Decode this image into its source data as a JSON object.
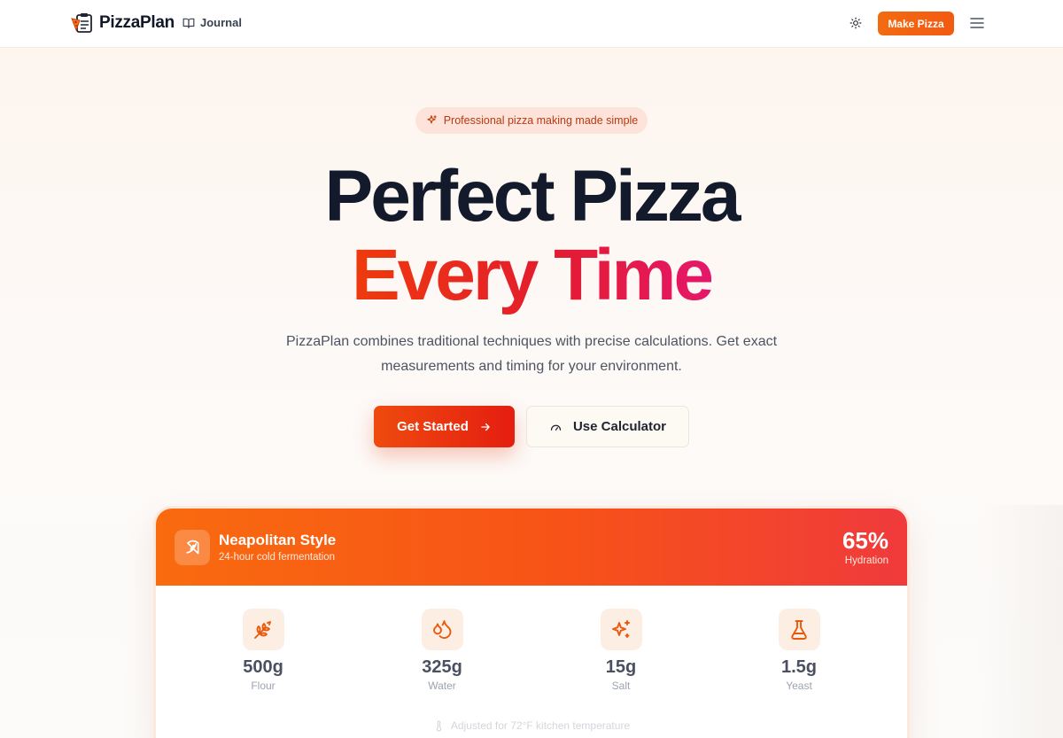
{
  "header": {
    "brand": "PizzaPlan",
    "nav_journal": "Journal",
    "make_button": "Make Pizza"
  },
  "hero": {
    "pill": "Professional pizza making made simple",
    "title_line1": "Perfect Pizza",
    "title_line2": "Every Time",
    "subtitle": "PizzaPlan combines traditional techniques with precise calculations. Get exact measurements and timing for your environment.",
    "primary_button": "Get Started",
    "secondary_button": "Use Calculator"
  },
  "recipe": {
    "title": "Neapolitan Style",
    "subtitle": "24-hour cold fermentation",
    "hydration_value": "65%",
    "hydration_label": "Hydration",
    "ingredients": [
      {
        "value": "500g",
        "label": "Flour",
        "icon": "wheat-icon"
      },
      {
        "value": "325g",
        "label": "Water",
        "icon": "droplets-icon"
      },
      {
        "value": "15g",
        "label": "Salt",
        "icon": "sparkles-icon"
      },
      {
        "value": "1.5g",
        "label": "Yeast",
        "icon": "flask-icon"
      }
    ],
    "adjust_note": "Adjusted for 72°F kitchen temperature"
  },
  "colors": {
    "accent": "#f97316",
    "accent_red": "#e51d10",
    "title_dark": "#131a2b",
    "pill_bg": "#fde3d9"
  }
}
